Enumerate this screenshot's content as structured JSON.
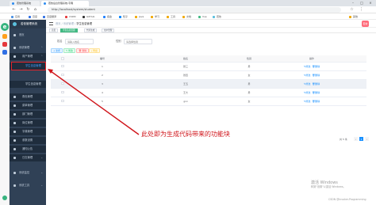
{
  "browser": {
    "tabs": [
      {
        "label": "若依管理系统",
        "active": false
      },
      {
        "label": "若依后台管理系统-字典",
        "active": true
      }
    ],
    "url": "http://localhost/system/student",
    "bookmarks": [
      "应用",
      "百度",
      "百度翻译",
      "CSDN",
      "GitHub",
      "掘金",
      "知乎",
      "Java",
      "学习",
      "工具",
      "文档",
      "Vue",
      "若依",
      "其他"
    ]
  },
  "sidebar": {
    "title": "若依管理系统",
    "items": [
      {
        "label": "首页"
      },
      {
        "label": "系统管理"
      },
      {
        "label": "用户管理"
      },
      {
        "label": "学生信息管理"
      },
      {
        "label": "学生信息管理"
      },
      {
        "label": "角色管理"
      },
      {
        "label": "菜单管理"
      },
      {
        "label": "部门管理"
      },
      {
        "label": "岗位管理"
      },
      {
        "label": "字典管理"
      },
      {
        "label": "参数设置"
      },
      {
        "label": "通知公告"
      },
      {
        "label": "日志管理"
      },
      {
        "label": "系统监控"
      },
      {
        "label": "系统工具"
      }
    ]
  },
  "header": {
    "breadcrumb": [
      "首页",
      "系统管理"
    ],
    "breadcrumb_current": "学生信息管理",
    "avatar": "若依"
  },
  "tags": [
    "首页",
    "学生信息管理",
    "代码生成",
    "用户管理"
  ],
  "search": {
    "name_label": "姓名",
    "name_placeholder": "请输入姓名",
    "sex_label": "性别",
    "sex_placeholder": "请选择性别"
  },
  "toolbar": {
    "add": "+ 新增",
    "edit": "✎ 修改",
    "delete": "🗑 删除",
    "export": "⤓ 导出"
  },
  "table": {
    "headers": [
      "",
      "编号",
      "姓名",
      "性别",
      "操作"
    ],
    "rows": [
      {
        "id": "1",
        "name": "张三",
        "sex": "男"
      },
      {
        "id": "2",
        "name": "张四",
        "sex": "女"
      },
      {
        "id": "3",
        "name": "王五",
        "sex": "男"
      },
      {
        "id": "4",
        "name": "王大",
        "sex": "男"
      },
      {
        "id": "5",
        "name": "gxx",
        "sex": "女"
      }
    ],
    "op_edit": "✎修改",
    "op_delete": "🗑删除"
  },
  "pager": {
    "total": "共 5 条",
    "page": "1"
  },
  "annotation": "此处即为生成代码带来的功能块",
  "watermark": {
    "line1": "激活 Windows",
    "line2": "转到\"设置\"以激活 Windows。",
    "csdn": "CSDN @Invoker-Programming"
  },
  "colors": {
    "sidebar": "#304156",
    "accent": "#1890ff",
    "annotation": "#d0151b",
    "tag_active": "#42b983"
  }
}
